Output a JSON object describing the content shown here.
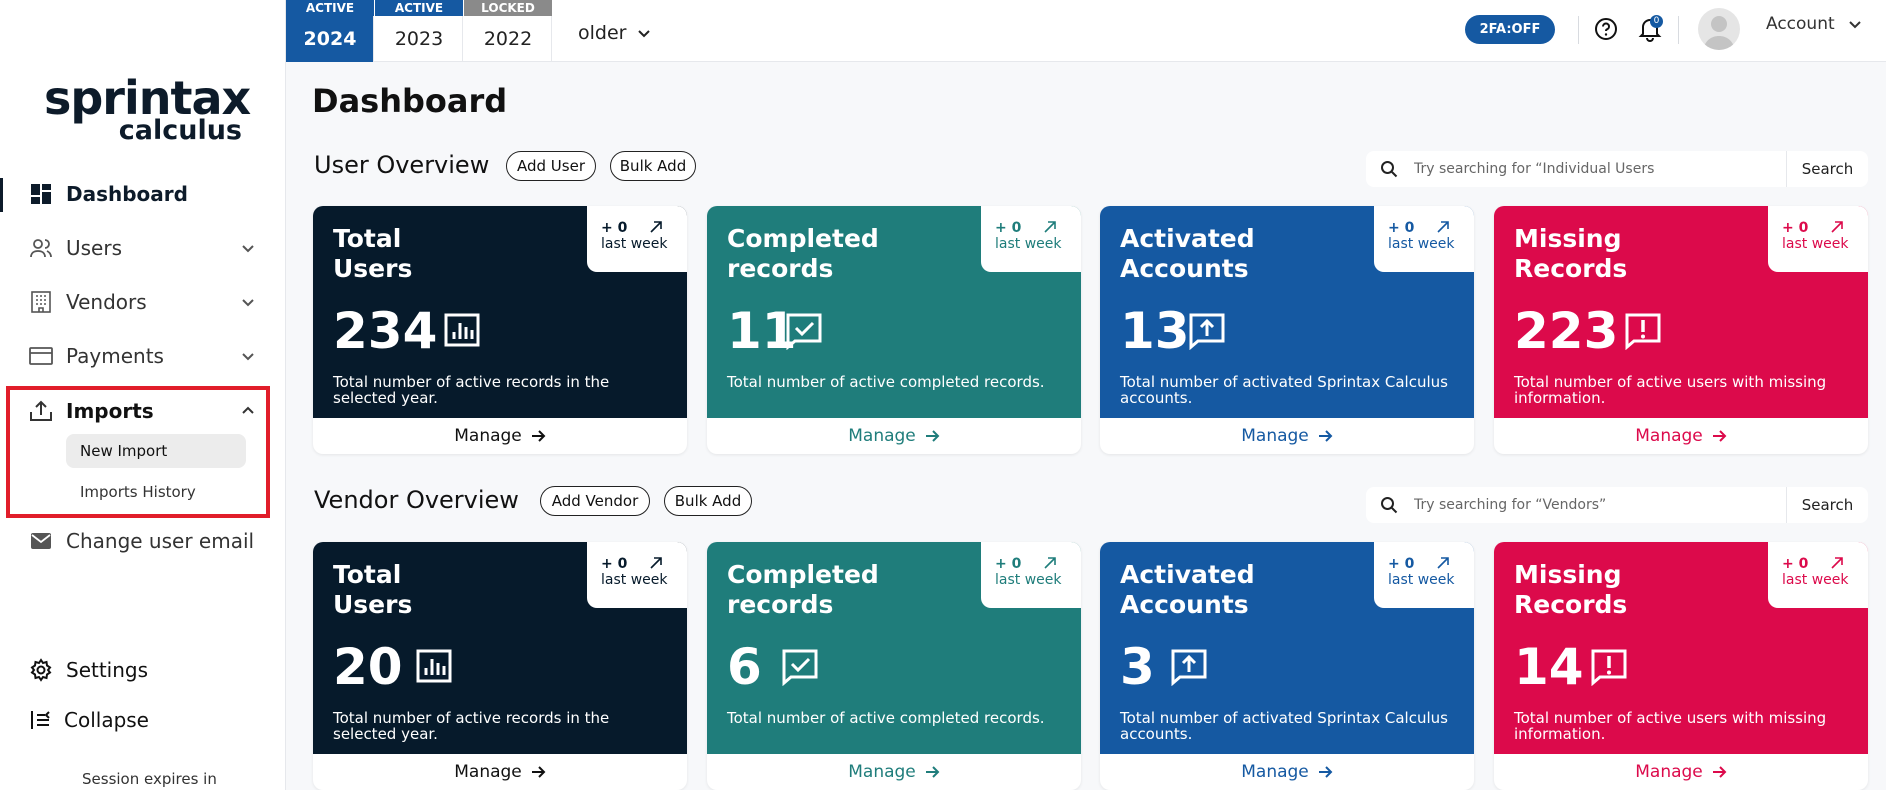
{
  "sidebar": {
    "logo": {
      "main": "sprintax",
      "sub": "calculus"
    },
    "items": [
      {
        "label": "Dashboard",
        "icon": "dashboard-icon"
      },
      {
        "label": "Users",
        "icon": "users-icon"
      },
      {
        "label": "Vendors",
        "icon": "vendors-icon"
      },
      {
        "label": "Payments",
        "icon": "payments-icon"
      },
      {
        "label": "Imports",
        "icon": "upload-icon"
      },
      {
        "label": "Change user email",
        "icon": "mail-icon"
      },
      {
        "label": "Settings",
        "icon": "gear-icon"
      },
      {
        "label": "Collapse",
        "icon": "collapse-icon"
      }
    ],
    "imports_sub": [
      "New Import",
      "Imports History"
    ],
    "session": "Session expires in"
  },
  "topbar": {
    "years": [
      {
        "badge": "ACTIVE",
        "label": "2024",
        "badge_color": "#1559a2",
        "selected": true
      },
      {
        "badge": "ACTIVE",
        "label": "2023",
        "badge_color": "#1559a2",
        "selected": false
      },
      {
        "badge": "LOCKED",
        "label": "2022",
        "badge_color": "#8a8a8a",
        "selected": false
      }
    ],
    "older": "older",
    "twofa": "2FA:OFF",
    "notifications": "0",
    "account": "Account"
  },
  "page_title": "Dashboard",
  "user_overview": {
    "title": "User Overview",
    "add": "Add User",
    "bulk": "Bulk Add",
    "search_placeholder": "Try searching for “Individual Users",
    "search_button": "Search",
    "cards": [
      {
        "title": "Total Users",
        "value": "234",
        "delta": "+ 0",
        "period": "last week",
        "desc": "Total number of active records in the selected year.",
        "manage": "Manage",
        "icon": "bar-chart-icon"
      },
      {
        "title": "Completed records",
        "value": "11",
        "delta": "+ 0",
        "period": "last week",
        "desc": "Total number of active completed records.",
        "manage": "Manage",
        "icon": "check-message-icon"
      },
      {
        "title": "Activated Accounts",
        "value": "13",
        "delta": "+ 0",
        "period": "last week",
        "desc": "Total number of activated Sprintax Calculus accounts.",
        "manage": "Manage",
        "icon": "upload-message-icon"
      },
      {
        "title": "Missing Records",
        "value": "223",
        "delta": "+ 0",
        "period": "last week",
        "desc": "Total number of active users with missing information.",
        "manage": "Manage",
        "icon": "alert-message-icon"
      }
    ]
  },
  "vendor_overview": {
    "title": "Vendor Overview",
    "add": "Add Vendor",
    "bulk": "Bulk Add",
    "search_placeholder": "Try searching for “Vendors”",
    "search_button": "Search",
    "cards": [
      {
        "title": "Total Users",
        "value": "20",
        "delta": "+ 0",
        "period": "last week",
        "desc": "Total number of active records in the selected year.",
        "manage": "Manage",
        "icon": "bar-chart-icon"
      },
      {
        "title": "Completed records",
        "value": "6",
        "delta": "+ 0",
        "period": "last week",
        "desc": "Total number of active completed records.",
        "manage": "Manage",
        "icon": "check-message-icon"
      },
      {
        "title": "Activated Accounts",
        "value": "3",
        "delta": "+ 0",
        "period": "last week",
        "desc": "Total number of activated Sprintax Calculus accounts.",
        "manage": "Manage",
        "icon": "upload-message-icon"
      },
      {
        "title": "Missing Records",
        "value": "14",
        "delta": "+ 0",
        "period": "last week",
        "desc": "Total number of active users with missing information.",
        "manage": "Manage",
        "icon": "alert-message-icon"
      }
    ]
  },
  "colors": {
    "navy": "#061a2b",
    "teal": "#1f7d7b",
    "blue": "#1559a2",
    "crimson": "#dc0a4b",
    "highlight_box": "#e11d2a"
  }
}
